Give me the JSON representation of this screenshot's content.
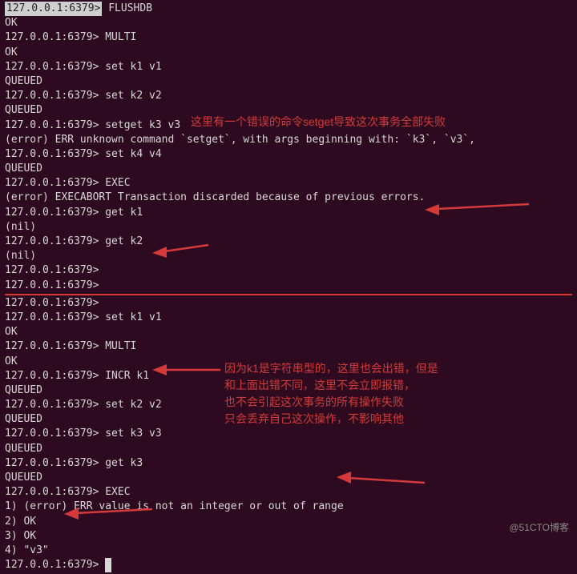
{
  "prompt": "127.0.0.1:6379>",
  "ok": "OK",
  "queued": "QUEUED",
  "nil": "(nil)",
  "top": {
    "sel": "127.0.0.1:6379>",
    "flushdb": "FLUSHDB",
    "multi": "MULTI",
    "set1": "set k1 v1",
    "set2": "set k2 v2",
    "setget": "setget k3 v3",
    "err_setget": "(error) ERR unknown command `setget`, with args beginning with: `k3`, `v3`,",
    "set4": "set k4 v4",
    "exec": "EXEC",
    "err_exec": "(error) EXECABORT Transaction discarded because of previous errors.",
    "get1": "get k1",
    "get2": "get k2"
  },
  "bot": {
    "set1": "set k1 v1",
    "multi": "MULTI",
    "incr": "INCR k1",
    "set2": "set k2 v2",
    "set3": "set k3 v3",
    "get3": "get k3",
    "exec": "EXEC",
    "r1": "1) (error) ERR value is not an integer or out of range",
    "r2": "2) OK",
    "r3": "3) OK",
    "r4": "4) \"v3\""
  },
  "anno": {
    "a1": "这里有一个错误的命令setget导致这次事务全部失败",
    "a2_l1": "因为k1是字符串型的，这里也会出错，但是",
    "a2_l2": "和上面出错不同，这里不会立即报错，",
    "a2_l3": "也不会引起这次事务的所有操作失败",
    "a2_l4": "只会丢弃自己这次操作，不影响其他"
  },
  "watermark": "@51CTO博客"
}
